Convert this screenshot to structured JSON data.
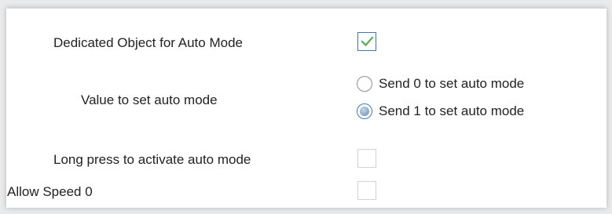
{
  "settings": {
    "dedicated_object": {
      "label": "Dedicated Object for Auto Mode",
      "checked": true
    },
    "value_auto_mode": {
      "label": "Value to set auto mode",
      "options": [
        {
          "label": "Send 0 to set auto mode",
          "selected": false
        },
        {
          "label": "Send 1 to set auto mode",
          "selected": true
        }
      ]
    },
    "long_press": {
      "label": "Long press to activate auto mode",
      "checked": false
    },
    "allow_speed_0": {
      "label": "Allow Speed 0",
      "checked": false
    }
  },
  "colors": {
    "check_mark": "#4caf50",
    "checkbox_border_checked": "#3b79b7",
    "radio_selected": "#7e9bbb"
  },
  "icons": {
    "check": "check-icon"
  }
}
